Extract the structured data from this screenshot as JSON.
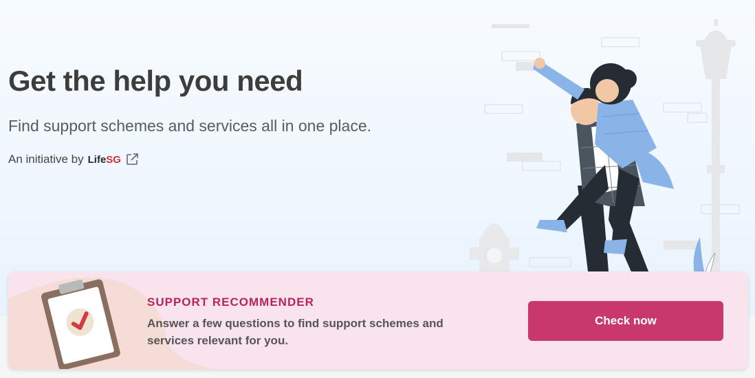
{
  "hero": {
    "title": "Get the help you need",
    "subtitle": "Find support schemes and services all in one place.",
    "initiative_prefix": "An initiative by",
    "brand_part1": "Life",
    "brand_part2": "SG",
    "external_icon": "external-link-icon"
  },
  "recommender": {
    "title": "SUPPORT RECOMMENDER",
    "description": "Answer a few questions to find support schemes and services relevant for you.",
    "button_label": "Check now",
    "icon": "clipboard-check-icon"
  },
  "colors": {
    "accent": "#c9386c",
    "title_accent": "#b8235a",
    "card_bg": "#f9e3ec",
    "brand_red": "#d6303a"
  }
}
